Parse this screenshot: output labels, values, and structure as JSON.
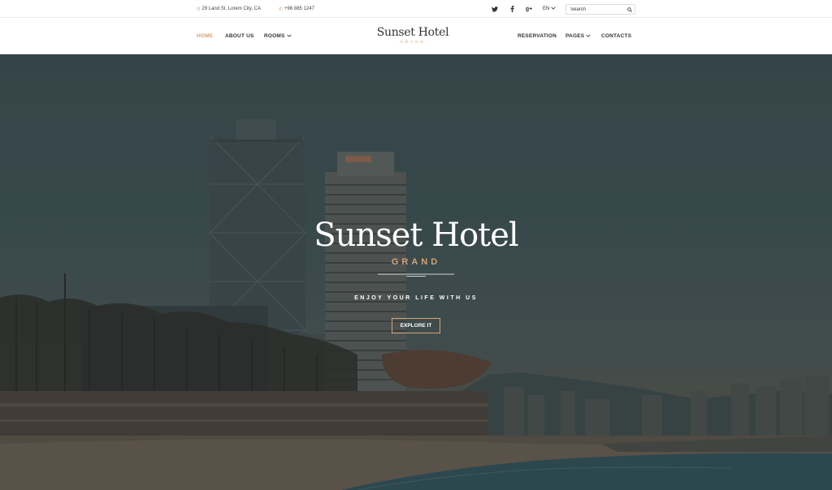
{
  "topbar": {
    "address": "29 Land St. Lorem City, CA",
    "phone": "+96 885 1247",
    "address_icon": "map-pin-icon",
    "phone_icon": "phone-icon",
    "socials": [
      {
        "name": "twitter-icon",
        "glyph": "t"
      },
      {
        "name": "facebook-icon",
        "glyph": "f"
      },
      {
        "name": "google-plus-icon",
        "glyph": "g+"
      }
    ],
    "language": "EN",
    "search_placeholder": "Search"
  },
  "nav": {
    "home": "HOME",
    "about": "ABOUT US",
    "rooms": "ROOMS",
    "reservation": "RESERVATION",
    "pages": "PAGES",
    "contacts": "CONTACTS",
    "active": "home"
  },
  "logo": {
    "name": "Sunset Hotel",
    "sub": "GRAND"
  },
  "hero": {
    "title": "Sunset Hotel",
    "subtitle": "GRAND",
    "tagline": "ENJOY YOUR LIFE WITH US",
    "cta": "EXPLORE IT",
    "building_sign": "MAPFRE"
  },
  "colors": {
    "accent": "#d4a373",
    "text": "#333333",
    "hero_overlay": "#2f3d40"
  }
}
